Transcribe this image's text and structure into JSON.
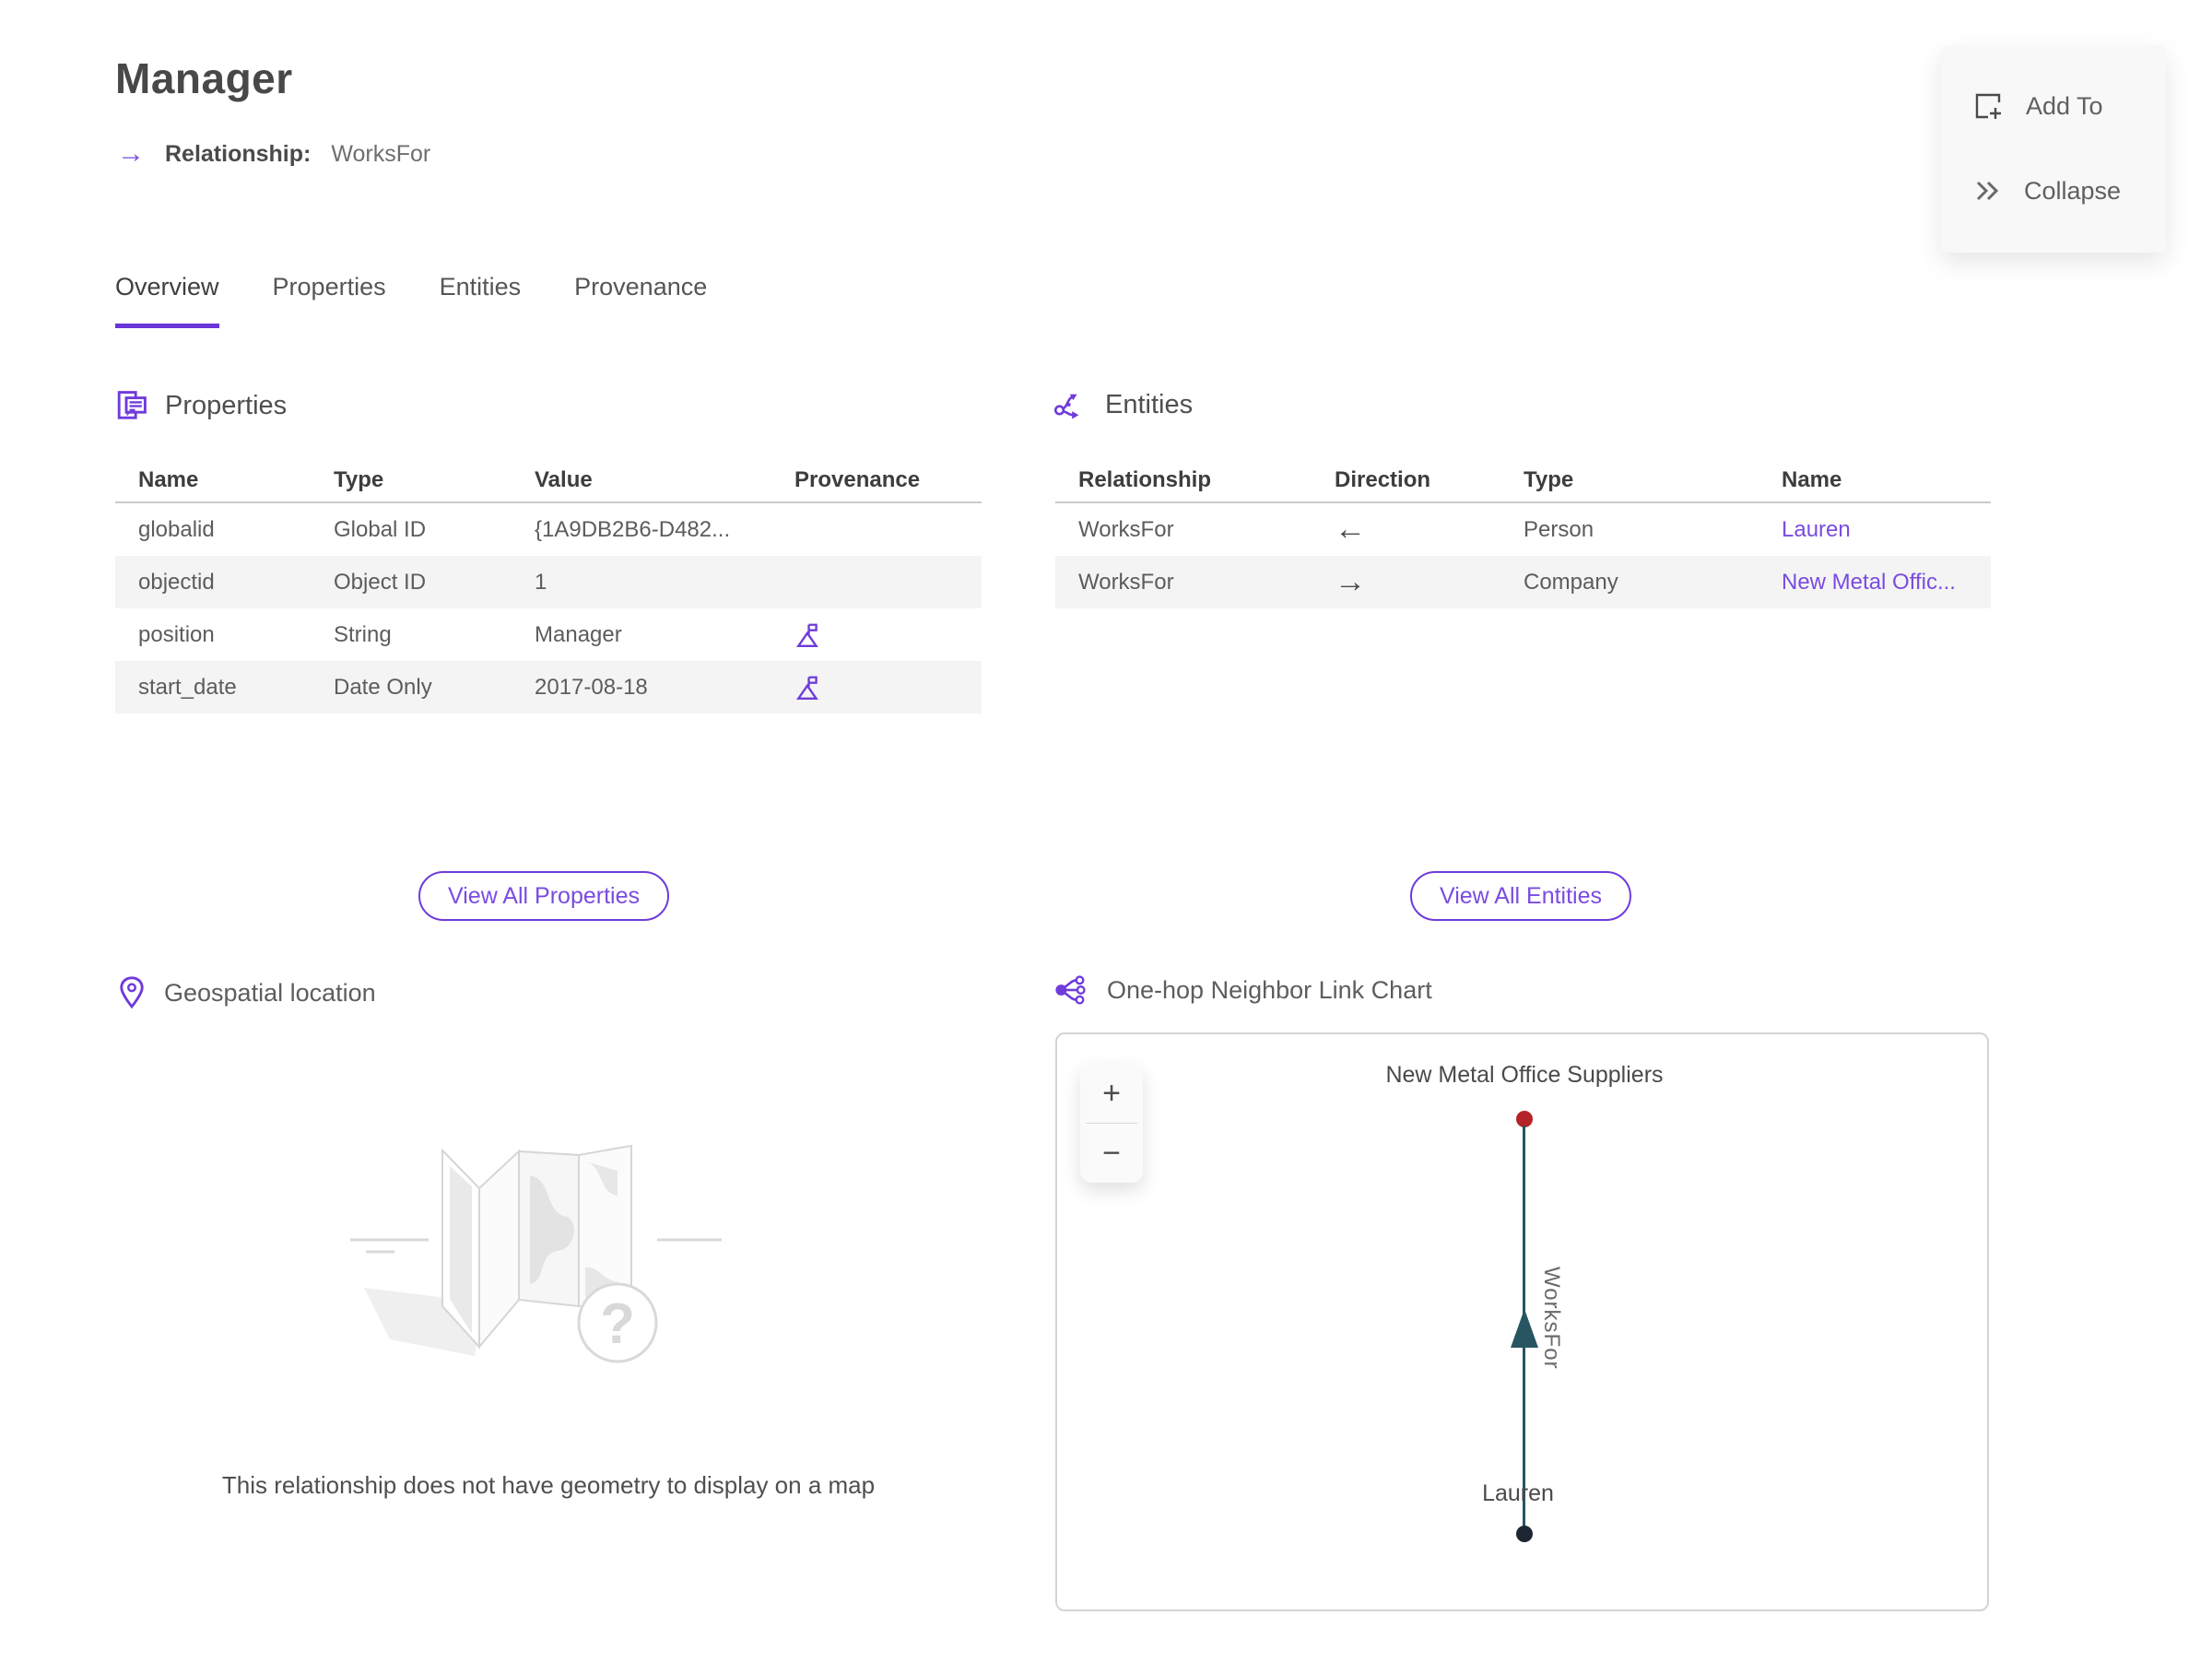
{
  "page": {
    "title": "Manager",
    "subtitle_icon": "→",
    "subtitle_label": "Relationship:",
    "subtitle_value": "WorksFor"
  },
  "actions": {
    "add_to": "Add To",
    "collapse": "Collapse"
  },
  "tabs": [
    {
      "label": "Overview",
      "active": true
    },
    {
      "label": "Properties",
      "active": false
    },
    {
      "label": "Entities",
      "active": false
    },
    {
      "label": "Provenance",
      "active": false
    }
  ],
  "properties_section": {
    "title": "Properties",
    "columns": [
      "Name",
      "Type",
      "Value",
      "Provenance"
    ],
    "rows": [
      {
        "name": "globalid",
        "type": "Global ID",
        "value": "{1A9DB2B6-D482...",
        "provenance": false
      },
      {
        "name": "objectid",
        "type": "Object ID",
        "value": "1",
        "provenance": false
      },
      {
        "name": "position",
        "type": "String",
        "value": "Manager",
        "provenance": true
      },
      {
        "name": "start_date",
        "type": "Date Only",
        "value": "2017-08-18",
        "provenance": true
      }
    ],
    "view_all_label": "View All Properties"
  },
  "entities_section": {
    "title": "Entities",
    "columns": [
      "Relationship",
      "Direction",
      "Type",
      "Name"
    ],
    "rows": [
      {
        "relationship": "WorksFor",
        "direction": "←",
        "type": "Person",
        "name": "Lauren"
      },
      {
        "relationship": "WorksFor",
        "direction": "→",
        "type": "Company",
        "name": "New Metal Offic..."
      }
    ],
    "view_all_label": "View All Entities"
  },
  "geospatial_section": {
    "title": "Geospatial location",
    "placeholder_glyph": "?",
    "empty_message": "This relationship does not have geometry to display on a map"
  },
  "link_chart_section": {
    "title": "One-hop Neighbor Link Chart",
    "zoom_in": "+",
    "zoom_out": "−",
    "chart_data": {
      "type": "node-link",
      "nodes": [
        {
          "label": "New Metal Office Suppliers",
          "entity_type": "Company",
          "color": "#b42328"
        },
        {
          "label": "Lauren",
          "entity_type": "Person",
          "color": "#1d2733"
        }
      ],
      "edges": [
        {
          "from": "Lauren",
          "to": "New Metal Office Suppliers",
          "label": "WorksFor",
          "color": "#275562"
        }
      ]
    }
  },
  "colors": {
    "accent_purple": "#6f3bdb",
    "link_purple": "#7a4be0",
    "row_alt_bg": "#f4f4f4",
    "edge_teal": "#275562",
    "node_company_red": "#b42328",
    "node_person_navy": "#1d2733"
  }
}
